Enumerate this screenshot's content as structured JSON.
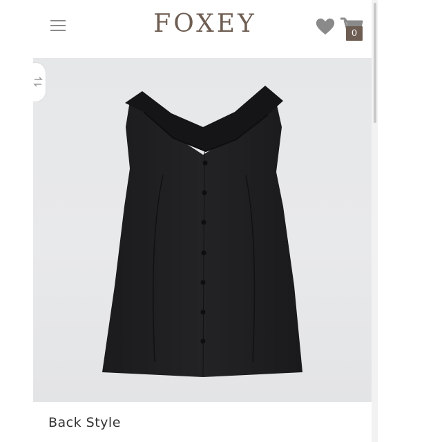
{
  "header": {
    "brand": "FOXEY",
    "menu_icon": "hamburger-menu-icon",
    "wishlist_icon": "heart-icon",
    "cart_icon": "shopping-cart-icon",
    "cart_count": "0"
  },
  "product": {
    "image_subject": "black sleeveless top with wide collar, back view",
    "caption": "Back Style"
  },
  "side_control": {
    "icon": "swap-arrows-icon"
  },
  "colors": {
    "brand": "#6e5d52",
    "icon_gray": "#8a8a8a",
    "image_background": "#e6e7e9"
  }
}
